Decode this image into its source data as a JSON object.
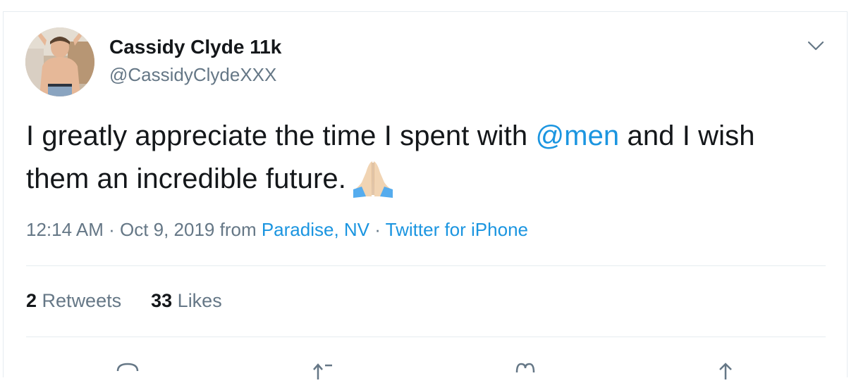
{
  "author": {
    "name": "Cassidy Clyde 11k",
    "handle": "@CassidyClydeXXX"
  },
  "tweet": {
    "text_before": "I greatly appreciate the time I spent with ",
    "mention": "@men",
    "text_after": " and I wish them an incredible future.",
    "emoji": "folded-hands-emoji"
  },
  "meta": {
    "time": "12:14 AM",
    "sep1": " · ",
    "date": "Oct 9, 2019",
    "from_label": " from ",
    "location": "Paradise, NV",
    "sep2": " · ",
    "source": "Twitter for iPhone"
  },
  "stats": {
    "retweets_count": "2",
    "retweets_label": "Retweets",
    "likes_count": "33",
    "likes_label": "Likes"
  },
  "actions": [
    "reply-icon",
    "retweet-icon",
    "like-icon",
    "share-icon"
  ],
  "colors": {
    "link": "#1b95e0",
    "secondary_text": "#657786",
    "primary_text": "#14171a",
    "divider": "#e6ecf0"
  }
}
